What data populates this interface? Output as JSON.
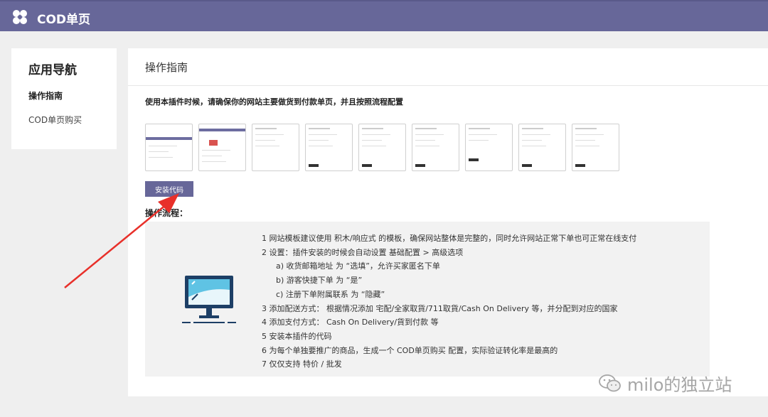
{
  "header": {
    "app_title": "COD单页",
    "logo_icon": "clover-icon",
    "color": "#676799"
  },
  "sidebar": {
    "title": "应用导航",
    "items": [
      {
        "label": "操作指南",
        "active": true
      },
      {
        "label": "COD单页购买",
        "active": false
      }
    ]
  },
  "main": {
    "title": "操作指南",
    "instruction": "使用本插件时候，请确保你的网站主要做货到付款单页，并且按照流程配置",
    "thumbnail_count": 9,
    "install_button": "安装代码",
    "process_label": "操作流程：",
    "steps": [
      "1 网站模板建议使用 积木/响应式 的模板，确保网站整体是完整的，同时允许网站正常下单也可正常在线支付",
      "2 设置：插件安装的时候会自动设置 基础配置 > 高级选项",
      "a) 收货邮箱地址 为 “选填”，允许买家匿名下单",
      "b) 游客快捷下单 为 “是”",
      "c) 注册下单附属联系 为 “隐藏”",
      "3 添加配送方式： 根据情况添加 宅配/全家取貨/711取貨/Cash On Delivery 等，并分配到对应的国家",
      "4 添加支付方式： Cash On Delivery/貨到付款 等",
      "5 安装本插件的代码",
      "6 为每个单独要推广的商品，生成一个 COD单页购买 配置，实际验证转化率是最高的",
      "7 仅仅支持 特价 / 批发"
    ],
    "illustration_icon": "monitor-icon"
  },
  "annotation": {
    "arrow_color": "#e8302a"
  },
  "watermark": {
    "text": "milo的独立站",
    "icon": "wechat-icon"
  }
}
